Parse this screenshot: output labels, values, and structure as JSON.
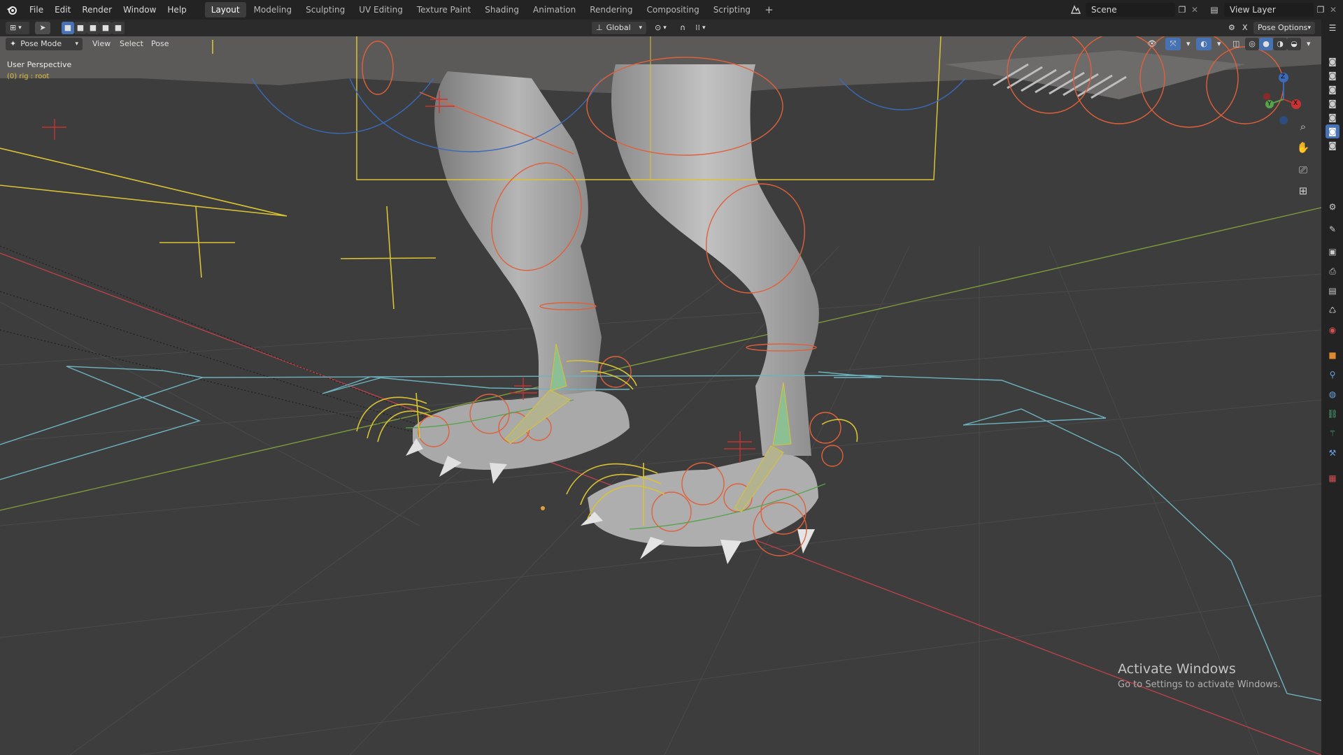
{
  "menu": {
    "items": [
      "File",
      "Edit",
      "Render",
      "Window",
      "Help"
    ]
  },
  "workspaces": {
    "tabs": [
      "Layout",
      "Modeling",
      "Sculpting",
      "UV Editing",
      "Texture Paint",
      "Shading",
      "Animation",
      "Rendering",
      "Compositing",
      "Scripting"
    ],
    "active": "Layout",
    "add_label": "+"
  },
  "scene": {
    "name": "Scene"
  },
  "view_layer": {
    "name": "View Layer"
  },
  "header": {
    "transform_orientation": "Global",
    "pose_options": "Pose Options"
  },
  "viewport_header": {
    "mode": "Pose Mode",
    "menus": [
      "View",
      "Select",
      "Pose"
    ]
  },
  "viewport": {
    "perspective_label": "User Perspective",
    "object_label": "(0) rig : root"
  },
  "gizmo": {
    "x": "X",
    "y": "Y",
    "z": "Z"
  },
  "watermark": {
    "title": "Activate Windows",
    "subtitle": "Go to Settings to activate Windows."
  },
  "colors": {
    "grid_x_axis": "#c0414a",
    "grid_y_axis": "#7fa13a",
    "bone_yellow": "#d9c333",
    "bone_orange": "#e0603a",
    "bone_blue": "#3a6ab8",
    "curve_cyan": "#6db3bf",
    "active_accent": "#4772b3"
  }
}
